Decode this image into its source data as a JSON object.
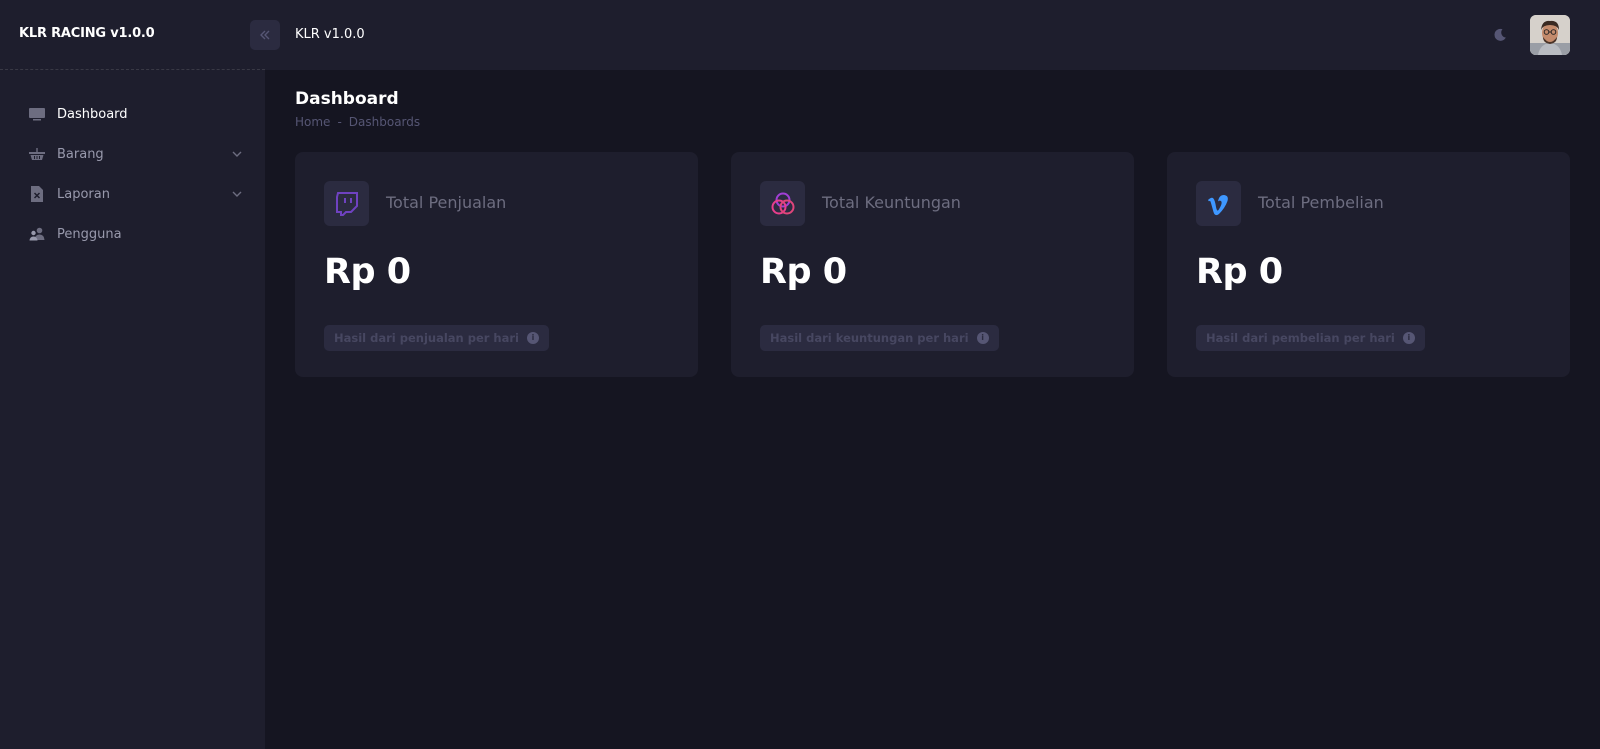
{
  "app": {
    "brand": "KLR RACING v1.0.0",
    "header_title": "KLR v1.0.0"
  },
  "sidebar": {
    "items": [
      {
        "label": "Dashboard",
        "icon": "monitor-icon",
        "active": true,
        "has_children": false
      },
      {
        "label": "Barang",
        "icon": "basket-icon",
        "active": false,
        "has_children": true
      },
      {
        "label": "Laporan",
        "icon": "file-x-icon",
        "active": false,
        "has_children": true
      },
      {
        "label": "Pengguna",
        "icon": "users-icon",
        "active": false,
        "has_children": false
      }
    ]
  },
  "page": {
    "title": "Dashboard",
    "breadcrumb": [
      "Home",
      "-",
      "Dashboards"
    ]
  },
  "cards": [
    {
      "label": "Total Penjualan",
      "value": "Rp 0",
      "note": "Hasil dari penjualan per hari",
      "icon": "twitch-icon",
      "icon_color": "#6f42c1"
    },
    {
      "label": "Total Keuntungan",
      "value": "Rp 0",
      "note": "Hasil dari keuntungan per hari",
      "icon": "circles-icon",
      "icon_color": "#e83e8c"
    },
    {
      "label": "Total Pembelian",
      "value": "Rp 0",
      "note": "Hasil dari pembelian per hari",
      "icon": "vimeo-icon",
      "icon_color": "#3e97ff"
    }
  ],
  "colors": {
    "page_bg": "#151521",
    "panel_bg": "#1e1e2d",
    "muted_text": "#9899ac"
  }
}
